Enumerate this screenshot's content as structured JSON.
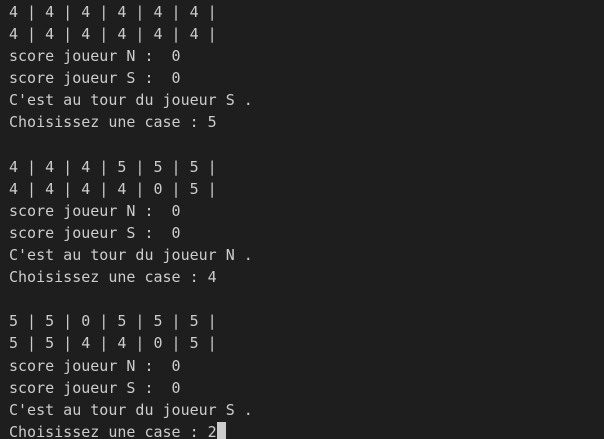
{
  "terminal": {
    "lines": [
      "4 | 4 | 4 | 4 | 4 | 4 |",
      "4 | 4 | 4 | 4 | 4 | 4 |",
      "score joueur N :  0",
      "score joueur S :  0",
      "C'est au tour du joueur S .",
      "Choisissez une case : 5",
      "",
      "4 | 4 | 4 | 5 | 5 | 5 |",
      "4 | 4 | 4 | 4 | 0 | 5 |",
      "score joueur N :  0",
      "score joueur S :  0",
      "C'est au tour du joueur N .",
      "Choisissez une case : 4",
      "",
      "5 | 5 | 0 | 5 | 5 | 5 |",
      "5 | 5 | 4 | 4 | 0 | 5 |",
      "score joueur N :  0",
      "score joueur S :  0",
      "C'est au tour du joueur S .",
      "Choisissez une case : 2"
    ]
  },
  "colors": {
    "background": "#1e1e1e",
    "text": "#cccccc"
  }
}
